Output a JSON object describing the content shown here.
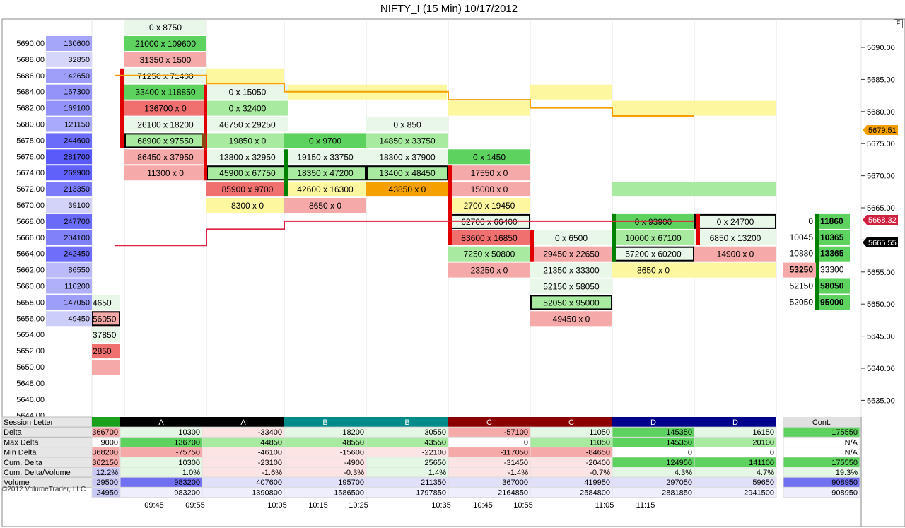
{
  "title": "NIFTY_I (15 Min)  10/17/2012",
  "flag_label": "F",
  "copyright": "©2012 VolumeTrader, LLC",
  "colors": {
    "sell": "#f6a9a9",
    "sell_strong": "#f07070",
    "buy": "#a8eaa0",
    "buy_strong": "#5ed25e",
    "neutral": "#e9f7e9",
    "highlight": "#fdf7a0",
    "orange": "#f5a000",
    "vwap_red": "#e02040",
    "profile": "#8e8ef5"
  },
  "chart_data": {
    "type": "table",
    "price_levels": [
      "5690.00",
      "5688.00",
      "5686.00",
      "5684.00",
      "5682.00",
      "5680.00",
      "5678.00",
      "5676.00",
      "5674.00",
      "5672.00",
      "5670.00",
      "5668.00",
      "5666.00",
      "5664.00",
      "5662.00",
      "5660.00",
      "5658.00",
      "5656.00",
      "5654.00",
      "5652.00",
      "5650.00",
      "5648.00",
      "5646.00",
      "5644.00"
    ],
    "volume_profile": [
      "130600",
      "32850",
      "142650",
      "167300",
      "169100",
      "121150",
      "244600",
      "281700",
      "269900",
      "213350",
      "39100",
      "247700",
      "204100",
      "242450",
      "86550",
      "110200",
      "147050",
      "49450",
      "",
      "",
      "",
      "",
      "",
      ""
    ],
    "profile_values": [
      130600,
      32850,
      142650,
      167300,
      169100,
      121150,
      244600,
      281700,
      269900,
      213350,
      39100,
      247700,
      204100,
      242450,
      86550,
      110200,
      147050,
      49450
    ],
    "right_axis_ticks": [
      "5690.00",
      "5685.00",
      "5680.00",
      "5675.00",
      "5670.00",
      "5665.00",
      "5660.00",
      "5655.00",
      "5650.00",
      "5645.00",
      "5640.00",
      "5635.00"
    ],
    "right_axis_values": [
      5690,
      5685,
      5680,
      5675,
      5670,
      5665,
      5660,
      5655,
      5650,
      5645,
      5640,
      5635
    ],
    "price_badges": [
      {
        "label": "5679.51",
        "color": "orange"
      },
      {
        "label": "5668.32",
        "color": "red"
      },
      {
        "label": "5665.55",
        "color": "black"
      }
    ],
    "columns": [
      {
        "label": "partial",
        "cells": [
          {
            "p": 5658,
            "t": "4650",
            "c": "neutral"
          },
          {
            "p": 5656,
            "t": "56050",
            "c": "sell",
            "box": true
          },
          {
            "p": 5654,
            "t": "37850",
            "c": "neutral"
          },
          {
            "p": 5652,
            "t": "2850",
            "c": "sell_strong"
          },
          {
            "p": 5650,
            "t": "",
            "c": "sell"
          }
        ]
      },
      {
        "label": "09:45",
        "cells": [
          {
            "p": 5692,
            "t": "0 x 8750",
            "c": "neutral"
          },
          {
            "p": 5690,
            "t": "21000 x 109600",
            "c": "buy_strong"
          },
          {
            "p": 5688,
            "t": "31350 x 1500",
            "c": "sell"
          },
          {
            "p": 5686,
            "t": "71250 x 71400",
            "c": "neutral"
          },
          {
            "p": 5684,
            "t": "33400 x 118850",
            "c": "buy_strong"
          },
          {
            "p": 5682,
            "t": "136700 x 0",
            "c": "sell_strong"
          },
          {
            "p": 5680,
            "t": "26100 x 18200",
            "c": "neutral"
          },
          {
            "p": 5678,
            "t": "68900 x 97550",
            "c": "buy",
            "box": true
          },
          {
            "p": 5676,
            "t": "86450 x 37950",
            "c": "sell"
          },
          {
            "p": 5674,
            "t": "11300 x 0",
            "c": "sell"
          }
        ]
      },
      {
        "label": "09:55",
        "cells": [
          {
            "p": 5684,
            "t": "0 x 15050",
            "c": "neutral"
          },
          {
            "p": 5682,
            "t": "0 x 32400",
            "c": "buy"
          },
          {
            "p": 5680,
            "t": "46750 x 29250",
            "c": "neutral"
          },
          {
            "p": 5678,
            "t": "19850 x 0",
            "c": "buy"
          },
          {
            "p": 5676,
            "t": "13800 x 32950",
            "c": "neutral"
          },
          {
            "p": 5674,
            "t": "45900 x 67750",
            "c": "buy",
            "box": true
          },
          {
            "p": 5672,
            "t": "85900 x 9700",
            "c": "sell_strong"
          },
          {
            "p": 5670,
            "t": "8300 x 0",
            "c": "highlight"
          }
        ]
      },
      {
        "label": "10:05",
        "cells": [
          {
            "p": 5678,
            "t": "0 x 9700",
            "c": "buy_strong"
          },
          {
            "p": 5676,
            "t": "19150 x 33750",
            "c": "neutral"
          },
          {
            "p": 5674,
            "t": "18350 x 47200",
            "c": "buy",
            "box": true
          },
          {
            "p": 5672,
            "t": "42600 x 16300",
            "c": "highlight"
          },
          {
            "p": 5670,
            "t": "8650 x 0",
            "c": "sell"
          }
        ]
      },
      {
        "label": "10:15",
        "cells": [
          {
            "p": 5680,
            "t": "0 x 850",
            "c": "neutral"
          },
          {
            "p": 5678,
            "t": "14850 x 33750",
            "c": "buy"
          },
          {
            "p": 5676,
            "t": "18300 x 37900",
            "c": "neutral"
          },
          {
            "p": 5674,
            "t": "13400 x 48450",
            "c": "buy",
            "box": true
          },
          {
            "p": 5672,
            "t": "43850 x 0",
            "c": "orange"
          }
        ]
      },
      {
        "label": "10:35",
        "cells": [
          {
            "p": 5676,
            "t": "0 x 1450",
            "c": "buy_strong"
          },
          {
            "p": 5674,
            "t": "17550 x 0",
            "c": "sell"
          },
          {
            "p": 5672,
            "t": "15000 x 0",
            "c": "sell"
          },
          {
            "p": 5670,
            "t": "2700 x 19450",
            "c": "highlight"
          },
          {
            "p": 5668,
            "t": "62700 x 66400",
            "c": "neutral",
            "box": true
          },
          {
            "p": 5666,
            "t": "83600 x 16850",
            "c": "sell_strong"
          },
          {
            "p": 5664,
            "t": "7250 x 50800",
            "c": "buy"
          },
          {
            "p": 5662,
            "t": "23250 x 0",
            "c": "sell"
          }
        ]
      },
      {
        "label": "10:45",
        "cells": [
          {
            "p": 5666,
            "t": "0 x 6500",
            "c": "neutral"
          },
          {
            "p": 5664,
            "t": "29450 x 22650",
            "c": "sell"
          },
          {
            "p": 5662,
            "t": "21350 x 33300",
            "c": "neutral"
          },
          {
            "p": 5660,
            "t": "52150 x 58050",
            "c": "neutral"
          },
          {
            "p": 5658,
            "t": "52050 x 95000",
            "c": "buy",
            "box": true
          },
          {
            "p": 5656,
            "t": "49450 x 0",
            "c": "sell"
          }
        ]
      },
      {
        "label": "11:05",
        "cells": [
          {
            "p": 5668,
            "t": "0 x 93900",
            "c": "buy_strong"
          },
          {
            "p": 5666,
            "t": "10000 x 67100",
            "c": "buy"
          },
          {
            "p": 5664,
            "t": "57200 x 60200",
            "c": "neutral",
            "box": true
          },
          {
            "p": 5662,
            "t": "8650 x 0",
            "c": "highlight"
          }
        ]
      },
      {
        "label": "11:15",
        "cells": [
          {
            "p": 5668,
            "t": "0 x 24700",
            "c": "neutral",
            "box": true
          },
          {
            "p": 5666,
            "t": "6850 x 13200",
            "c": "neutral"
          },
          {
            "p": 5664,
            "t": "14900 x 0",
            "c": "sell"
          }
        ]
      }
    ],
    "last_column": [
      {
        "p": 5668,
        "l": "0",
        "r": "11860",
        "rc": "buy_strong"
      },
      {
        "p": 5666,
        "l": "10045",
        "r": "10365",
        "rc": "buy_strong"
      },
      {
        "p": 5664,
        "l": "10880",
        "r": "13365",
        "rc": "buy_strong"
      },
      {
        "p": 5662,
        "l": "53250",
        "r": "33300",
        "lc": "sell"
      },
      {
        "p": 5660,
        "l": "52150",
        "r": "58050",
        "rc": "buy_strong"
      },
      {
        "p": 5658,
        "l": "52050",
        "r": "95000",
        "rc": "buy_strong"
      }
    ],
    "summary": {
      "row_labels": [
        "Session Letter",
        "Delta",
        "Max Delta",
        "Min Delta",
        "Cum. Delta",
        "Cum. Delta/Volume",
        "Volume"
      ],
      "headers": [
        "",
        "A",
        "A",
        "B",
        "B",
        "C",
        "C",
        "D",
        "D",
        "Cont."
      ],
      "header_colors": [
        "#1aa01a",
        "#000000",
        "#000000",
        "#008b8b",
        "#008b8b",
        "#8b0000",
        "#8b0000",
        "#00008b",
        "#00008b",
        "#e0e0e0"
      ],
      "rows": [
        [
          "366700",
          "10300",
          "-33400",
          "18200",
          "30550",
          "-57100",
          "11050",
          "145350",
          "16150",
          "175550"
        ],
        [
          "9000",
          "136700",
          "44850",
          "48550",
          "43550",
          "0",
          "11050",
          "145350",
          "20100",
          "N/A"
        ],
        [
          "368200",
          "-75750",
          "-46100",
          "-15600",
          "-22100",
          "-117050",
          "-84650",
          "0",
          "0",
          "N/A"
        ],
        [
          "362150",
          "10300",
          "-23100",
          "-4900",
          "25650",
          "-31450",
          "-20400",
          "124950",
          "141100",
          "175550"
        ],
        [
          "12.2%",
          "1.0%",
          "-1.6%",
          "-0.3%",
          "1.4%",
          "-1.4%",
          "-0.7%",
          "4.3%",
          "4.7%",
          "19.3%"
        ],
        [
          "29500",
          "983200",
          "407600",
          "195700",
          "211350",
          "367000",
          "419950",
          "297050",
          "59650",
          "908950"
        ],
        [
          "24950",
          "983200",
          "1390800",
          "1586500",
          "1797850",
          "2164850",
          "2584800",
          "2881850",
          "2941500",
          "908950"
        ]
      ]
    },
    "x_ticks": [
      "09:45",
      "09:55",
      "10:05",
      "10:15",
      "10:25",
      "10:35",
      "10:45",
      "10:55",
      "11:05",
      "11:15"
    ],
    "orange_line": [
      5686,
      5686,
      5685,
      5684,
      5684,
      5683,
      5682,
      5681,
      5680,
      5680
    ],
    "red_line": [
      5665,
      5665,
      5667,
      5668,
      5668,
      5668,
      5668,
      5668,
      5668,
      5668
    ]
  }
}
